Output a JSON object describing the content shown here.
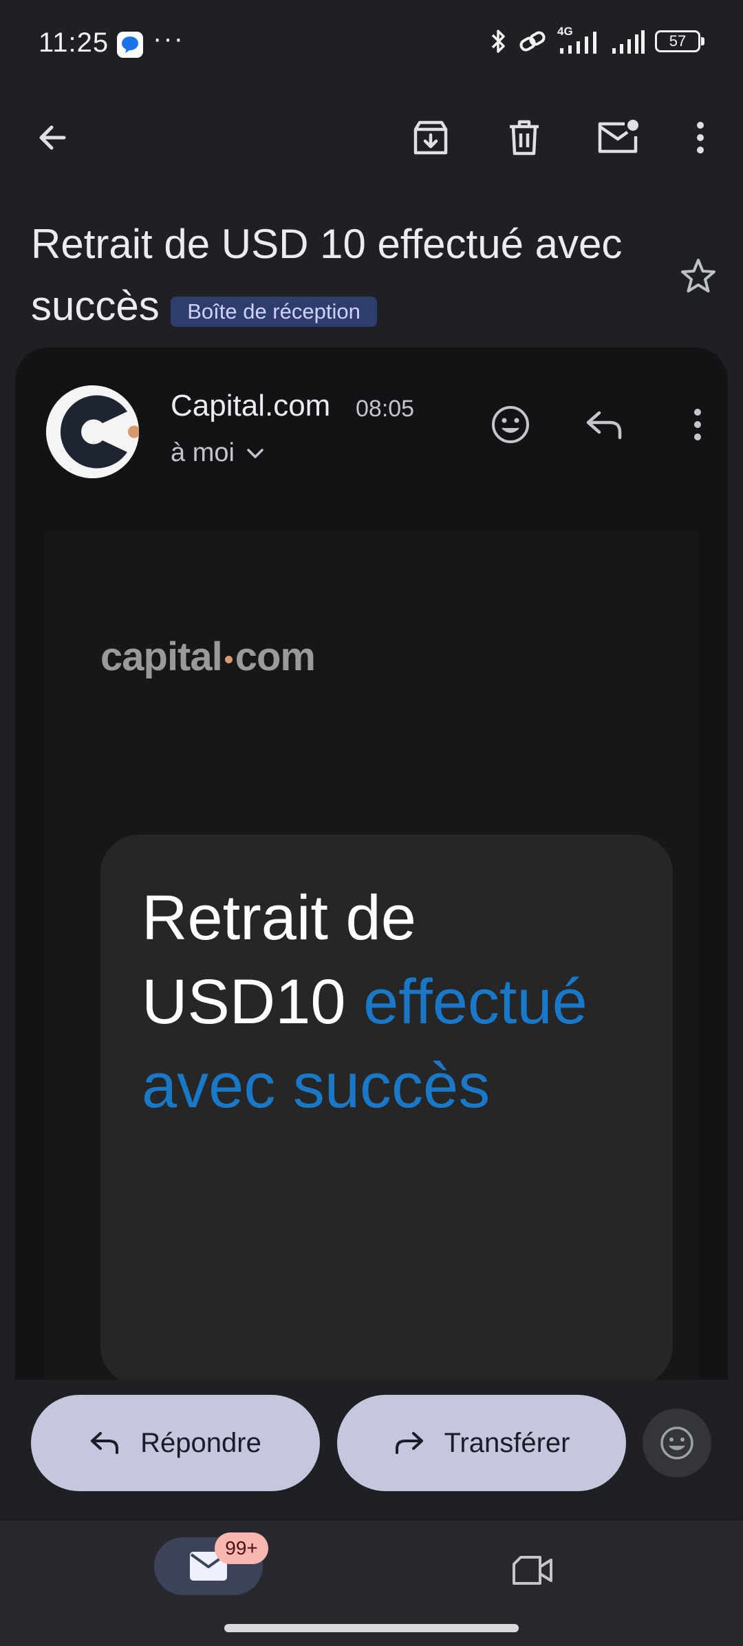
{
  "status_bar": {
    "time": "11:25",
    "more": "···",
    "network_label": "4G",
    "battery": "57"
  },
  "toolbar": {
    "back_icon": "arrow-left-icon",
    "archive_icon": "archive-icon",
    "delete_icon": "trash-icon",
    "mark_unread_icon": "mail-unread-icon",
    "more_icon": "more-vert-icon"
  },
  "subject": {
    "title": "Retrait de USD 10 effectué avec succès",
    "label_chip": "Boîte de réception"
  },
  "message": {
    "sender": "Capital.com",
    "time": "08:05",
    "recipient": "à moi"
  },
  "email_body": {
    "logo_left": "capital",
    "logo_right": "com",
    "heading_plain": "Retrait de USD10",
    "heading_accent": "effectué avec succès"
  },
  "reply_bar": {
    "reply_label": "Répondre",
    "forward_label": "Transférer"
  },
  "bottom_nav": {
    "mail_badge": "99+"
  },
  "colors": {
    "background": "#1f2024",
    "accent_blue": "#1a78c8",
    "chip_bg": "#2f3c6e",
    "pill_bg": "#c4c7de",
    "badge_bg": "#f9b7b1"
  }
}
